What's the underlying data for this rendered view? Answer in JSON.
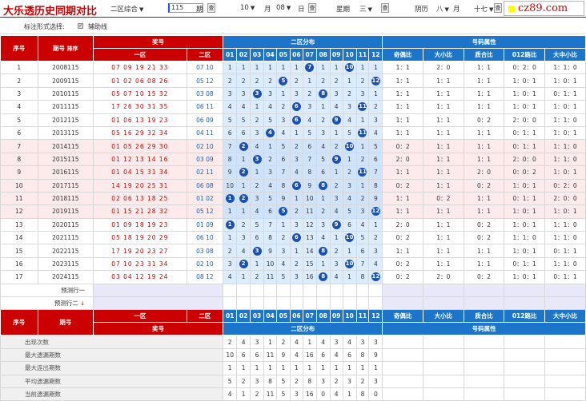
{
  "title": "大乐透历史同期对比",
  "controls": {
    "mode": "二区综合",
    "issue": "115",
    "issue_unit": "期",
    "month": "10",
    "month_unit": "月",
    "day": "08",
    "day_unit": "日",
    "weekday_label": "星期",
    "weekday": "三",
    "lunar_label": "阴历",
    "lunar_month": "八",
    "lunar_month_unit": "月",
    "lunar_day": "十七",
    "query": "查"
  },
  "logo": "cz89.com",
  "options": {
    "label": "标注形式选择:",
    "assist_label": "辅助线"
  },
  "headers": {
    "seq": "序号",
    "period": "期号",
    "sort": "排序",
    "draw": "奖号",
    "zone1": "一区",
    "zone2": "二区",
    "dist": "二区分布",
    "attr": "号码属性",
    "nums": [
      "01",
      "02",
      "03",
      "04",
      "05",
      "06",
      "07",
      "08",
      "09",
      "10",
      "11",
      "12"
    ],
    "attrs": [
      "奇偶比",
      "大小比",
      "质合比",
      "012路比",
      "大中小比"
    ]
  },
  "rows": [
    {
      "seq": "1",
      "period": "2008115",
      "z1": "07 09 19 21 33",
      "z2": "07 10",
      "balls": [
        7,
        10
      ],
      "attrs": [
        "1：1",
        "2：0",
        "1：1",
        "0：2：0",
        "1：1：0"
      ]
    },
    {
      "seq": "2",
      "period": "2009115",
      "z1": "01 02 06 08 26",
      "z2": "05 12",
      "balls": [
        5,
        12
      ],
      "attrs": [
        "1：1",
        "1：1",
        "1：1",
        "1：0：1",
        "1：0：1"
      ]
    },
    {
      "seq": "3",
      "period": "2010115",
      "z1": "05 07 10 15 32",
      "z2": "03 08",
      "balls": [
        3,
        8
      ],
      "attrs": [
        "1：1",
        "1：1",
        "1：1",
        "1：0：1",
        "0：1：1"
      ]
    },
    {
      "seq": "4",
      "period": "2011115",
      "z1": "17 26 30 31 35",
      "z2": "06 11",
      "balls": [
        6,
        11
      ],
      "attrs": [
        "1：1",
        "1：1",
        "1：1",
        "1：0：1",
        "1：0：1"
      ]
    },
    {
      "seq": "5",
      "period": "2012115",
      "z1": "01 06 13 19 23",
      "z2": "06 09",
      "balls": [
        6,
        9
      ],
      "attrs": [
        "1：1",
        "1：1",
        "0：2",
        "2：0：0",
        "1：1：0"
      ]
    },
    {
      "seq": "6",
      "period": "2013115",
      "z1": "05 16 29 32 34",
      "z2": "04 11",
      "balls": [
        4,
        11
      ],
      "attrs": [
        "1：1",
        "1：1",
        "1：1",
        "0：1：1",
        "1：0：1"
      ]
    },
    {
      "seq": "7",
      "period": "2014115",
      "z1": "01 05 26 29 30",
      "z2": "02 10",
      "balls": [
        2,
        10
      ],
      "attrs": [
        "0：2",
        "1：1",
        "1：1",
        "0：1：1",
        "1：1：0"
      ]
    },
    {
      "seq": "8",
      "period": "2015115",
      "z1": "01 12 13 14 16",
      "z2": "03 09",
      "balls": [
        3,
        9
      ],
      "attrs": [
        "2：0",
        "1：1",
        "1：1",
        "2：0：0",
        "1：1：0"
      ]
    },
    {
      "seq": "9",
      "period": "2016115",
      "z1": "01 04 15 31 34",
      "z2": "02 11",
      "balls": [
        2,
        11
      ],
      "attrs": [
        "1：1",
        "1：1",
        "2：0",
        "0：0：2",
        "1：0：1"
      ]
    },
    {
      "seq": "10",
      "period": "2017115",
      "z1": "14 19 20 25 31",
      "z2": "06 08",
      "balls": [
        6,
        8
      ],
      "attrs": [
        "0：2",
        "1：1",
        "0：2",
        "1：0：1",
        "0：2：0"
      ]
    },
    {
      "seq": "11",
      "period": "2018115",
      "z1": "02 06 13 18 25",
      "z2": "01 02",
      "balls": [
        1,
        2
      ],
      "attrs": [
        "1：1",
        "0：2",
        "1：1",
        "0：1：1",
        "2：0：0"
      ]
    },
    {
      "seq": "12",
      "period": "2019115",
      "z1": "01 15 21 28 32",
      "z2": "05 12",
      "balls": [
        5,
        12
      ],
      "attrs": [
        "1：1",
        "1：1",
        "1：1",
        "1：0：1",
        "1：0：1"
      ]
    },
    {
      "seq": "13",
      "period": "2020115",
      "z1": "01 09 18 19 23",
      "z2": "01 09",
      "balls": [
        1,
        9
      ],
      "attrs": [
        "2：0",
        "1：1",
        "0：2",
        "1：0：1",
        "1：1：0"
      ]
    },
    {
      "seq": "14",
      "period": "2021115",
      "z1": "05 18 19 20 29",
      "z2": "06 10",
      "balls": [
        6,
        10
      ],
      "attrs": [
        "0：2",
        "1：1",
        "0：2",
        "1：1：0",
        "1：1：0"
      ]
    },
    {
      "seq": "15",
      "period": "2022115",
      "z1": "17 19 20 23 27",
      "z2": "03 08",
      "balls": [
        3,
        8
      ],
      "attrs": [
        "1：1",
        "1：1",
        "1：1",
        "1：0：1",
        "0：1：1"
      ]
    },
    {
      "seq": "16",
      "period": "2023115",
      "z1": "07 10 23 31 34",
      "z2": "02 10",
      "balls": [
        2,
        10
      ],
      "attrs": [
        "0：2",
        "1：1",
        "1：1",
        "0：1：1",
        "1：1：0"
      ]
    },
    {
      "seq": "17",
      "period": "2024115",
      "z1": "03 04 12 19 24",
      "z2": "08 12",
      "balls": [
        8,
        12
      ],
      "attrs": [
        "0：2",
        "2：0",
        "0：2",
        "1：0：1",
        "0：1：1"
      ]
    }
  ],
  "gaps": [
    [
      1,
      1,
      1,
      1,
      1,
      1,
      0,
      1,
      1,
      0,
      1,
      1
    ],
    [
      2,
      2,
      2,
      2,
      0,
      2,
      1,
      2,
      2,
      1,
      2,
      0
    ],
    [
      3,
      3,
      0,
      3,
      1,
      3,
      2,
      0,
      3,
      2,
      3,
      1
    ],
    [
      4,
      4,
      1,
      4,
      2,
      0,
      3,
      1,
      4,
      3,
      0,
      2
    ],
    [
      5,
      5,
      2,
      5,
      3,
      0,
      4,
      2,
      0,
      4,
      1,
      3
    ],
    [
      6,
      6,
      3,
      0,
      4,
      1,
      5,
      3,
      1,
      5,
      0,
      4
    ],
    [
      7,
      0,
      4,
      1,
      5,
      2,
      6,
      4,
      2,
      0,
      1,
      5
    ],
    [
      8,
      1,
      0,
      2,
      6,
      3,
      7,
      5,
      0,
      1,
      2,
      6
    ],
    [
      9,
      0,
      1,
      3,
      7,
      4,
      8,
      6,
      1,
      2,
      0,
      7
    ],
    [
      10,
      1,
      2,
      4,
      8,
      0,
      9,
      0,
      2,
      3,
      1,
      8
    ],
    [
      0,
      0,
      3,
      5,
      9,
      1,
      10,
      1,
      3,
      4,
      2,
      9
    ],
    [
      1,
      1,
      4,
      6,
      0,
      2,
      11,
      2,
      4,
      5,
      3,
      0
    ],
    [
      0,
      2,
      5,
      7,
      1,
      3,
      12,
      3,
      0,
      6,
      4,
      1
    ],
    [
      1,
      3,
      6,
      8,
      2,
      0,
      13,
      4,
      1,
      0,
      5,
      2
    ],
    [
      2,
      4,
      0,
      9,
      3,
      1,
      14,
      0,
      2,
      1,
      6,
      3
    ],
    [
      3,
      0,
      1,
      10,
      4,
      2,
      15,
      1,
      3,
      0,
      7,
      4
    ],
    [
      4,
      1,
      2,
      11,
      5,
      3,
      16,
      0,
      4,
      1,
      8,
      0
    ]
  ],
  "pred": [
    "预测行一",
    "预测行二"
  ],
  "stats": [
    {
      "label": "出现次数",
      "vals": [
        "2",
        "4",
        "3",
        "1",
        "2",
        "4",
        "1",
        "4",
        "3",
        "4",
        "3",
        "3"
      ]
    },
    {
      "label": "最大遗漏期数",
      "vals": [
        "10",
        "6",
        "6",
        "11",
        "9",
        "4",
        "16",
        "6",
        "4",
        "6",
        "8",
        "9"
      ]
    },
    {
      "label": "最大连出期数",
      "vals": [
        "1",
        "1",
        "1",
        "1",
        "1",
        "1",
        "1",
        "1",
        "1",
        "1",
        "1",
        "1"
      ]
    },
    {
      "label": "平均遗漏期数",
      "vals": [
        "5",
        "2",
        "3",
        "8",
        "5",
        "2",
        "8",
        "3",
        "2",
        "3",
        "2",
        "3"
      ]
    },
    {
      "label": "当前遗漏期数",
      "vals": [
        "4",
        "1",
        "2",
        "11",
        "5",
        "3",
        "16",
        "0",
        "4",
        "1",
        "8",
        "0"
      ]
    }
  ]
}
